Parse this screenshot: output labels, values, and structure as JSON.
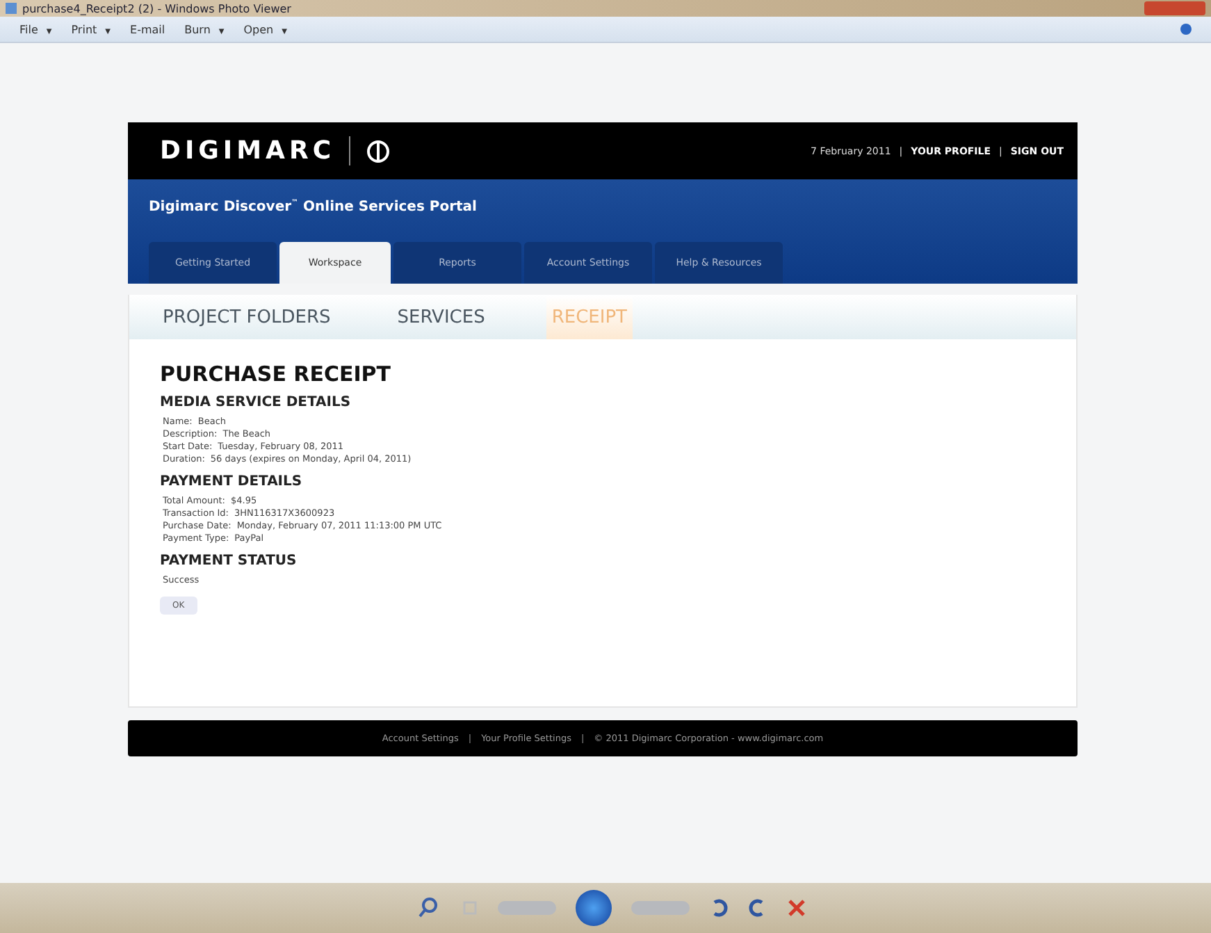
{
  "window": {
    "title": "purchase4_Receipt2 (2) - Windows Photo Viewer"
  },
  "menu": [
    {
      "label": "File",
      "caret": "▼"
    },
    {
      "label": "Print",
      "caret": "▼"
    },
    {
      "label": "E-mail"
    },
    {
      "label": "Burn",
      "caret": "▼"
    },
    {
      "label": "Open",
      "caret": "▼"
    }
  ],
  "site": {
    "logo": "DIGIMARC",
    "date": "7 February 2011",
    "links": [
      "YOUR PROFILE",
      "SIGN OUT"
    ],
    "portal": "Digimarc Discover",
    "tm": "™",
    "portal_rest": " Online Services Portal",
    "tabs": [
      {
        "label": "Getting Started",
        "selected": false
      },
      {
        "label": "Workspace",
        "selected": true
      },
      {
        "label": "Reports",
        "selected": false
      },
      {
        "label": "Account Settings",
        "selected": false
      },
      {
        "label": "Help & Resources",
        "selected": false
      }
    ],
    "subtabs": [
      {
        "label": "PROJECT FOLDERS",
        "selected": false
      },
      {
        "label": "SERVICES",
        "selected": false
      },
      {
        "label": "RECEIPT",
        "selected": true
      }
    ],
    "title": "PURCHASE RECEIPT",
    "sections": [
      {
        "heading": "MEDIA SERVICE DETAILS",
        "rows": [
          {
            "label": "Name:",
            "value": "Beach"
          },
          {
            "label": "Description:",
            "value": "The Beach"
          },
          {
            "label": "Start Date:",
            "value": "Tuesday, February 08, 2011"
          },
          {
            "label": "Duration:",
            "value": "56 days (expires on Monday, April 04, 2011)"
          }
        ]
      },
      {
        "heading": "PAYMENT DETAILS",
        "rows": [
          {
            "label": "Total Amount:",
            "value": "$4.95"
          },
          {
            "label": "Transaction Id:",
            "value": "3HN116317X3600923"
          },
          {
            "label": "Purchase Date:",
            "value": "Monday, February 07, 2011 11:13:00 PM UTC"
          },
          {
            "label": "Payment Type:",
            "value": "PayPal"
          }
        ]
      },
      {
        "heading": "PAYMENT STATUS",
        "rows": [
          {
            "label": "Success"
          }
        ]
      }
    ],
    "ok": "OK",
    "footer": [
      "Account Settings",
      "Your Profile Settings",
      "© 2011 Digimarc Corporation - www.digimarc.com"
    ],
    "footer_sep": "|"
  }
}
